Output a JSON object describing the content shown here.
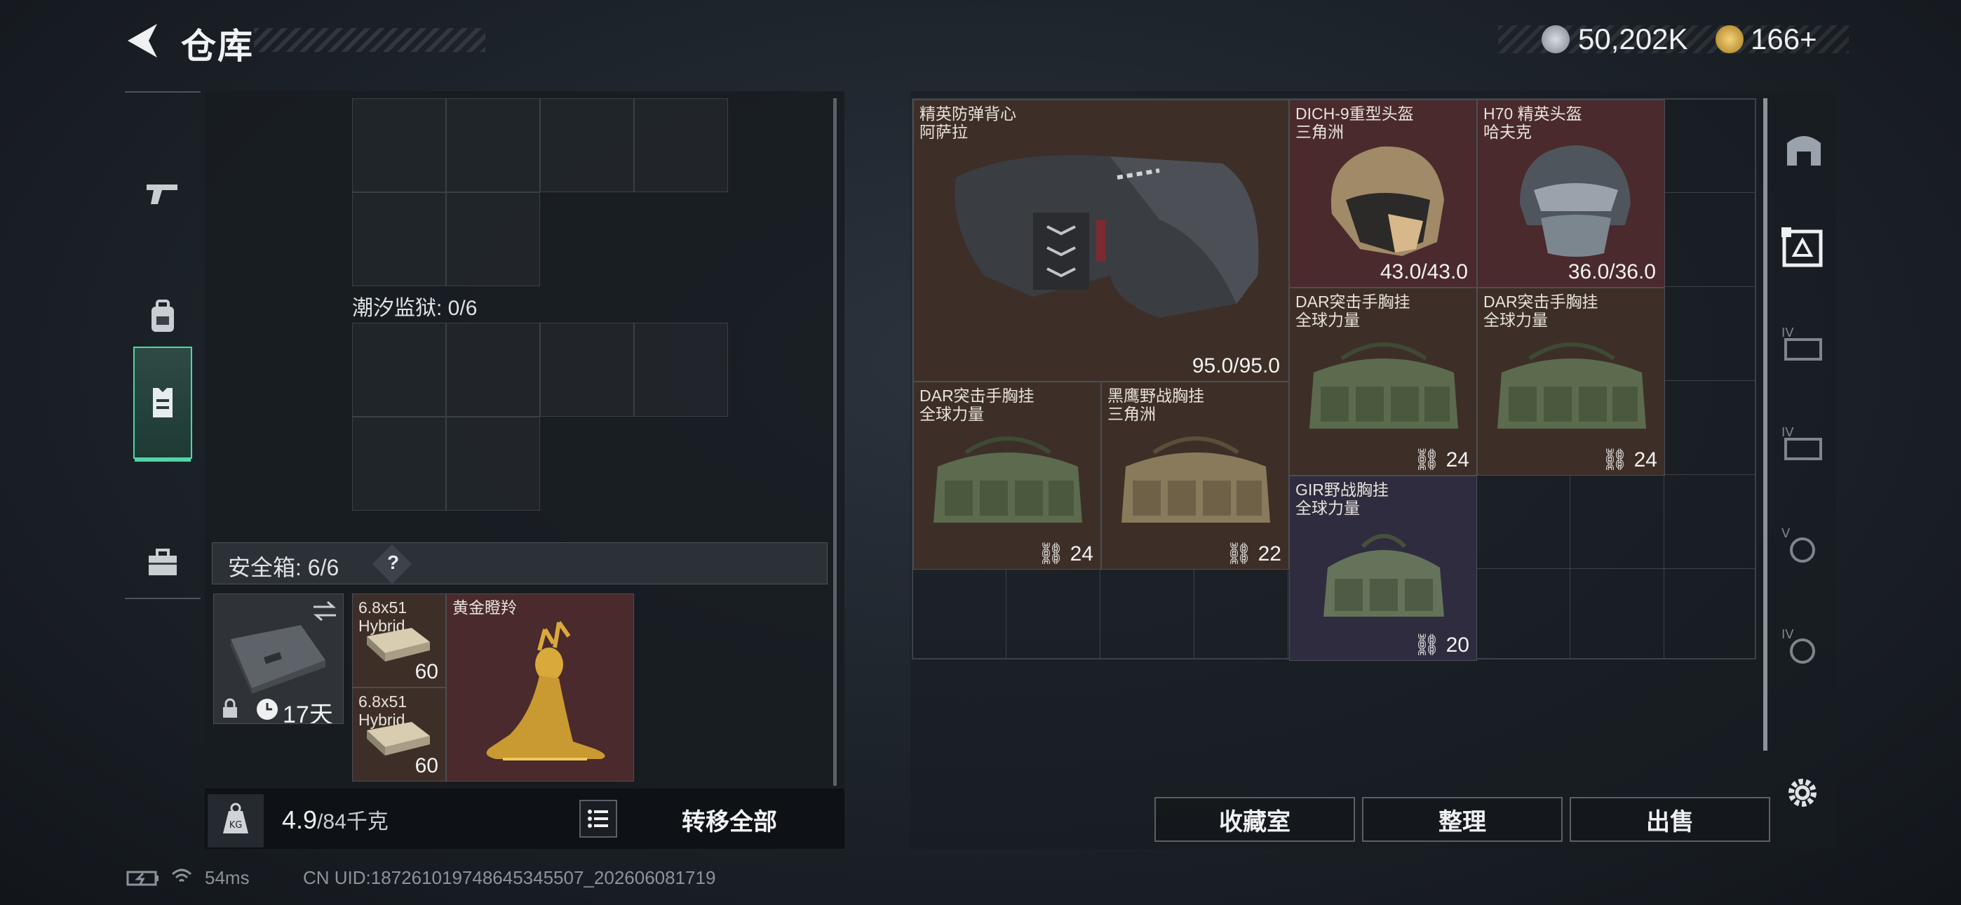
{
  "header": {
    "title": "仓库",
    "currency1": "50,202K",
    "currency2": "166+"
  },
  "sidebar": {
    "tabs": [
      {
        "icon": "pistol-icon"
      },
      {
        "icon": "backpack-icon"
      },
      {
        "icon": "vest-icon",
        "active": true
      },
      {
        "icon": "toolbox-icon"
      }
    ]
  },
  "left": {
    "prison_label": "潮汐监狱: 0/6",
    "safe_label": "安全箱:  6/6",
    "safe_help": "?",
    "case_days": "17天",
    "ammo1_name": "6.8x51\nHybrid",
    "ammo1_count": "60",
    "ammo2_name": "6.8x51\nHybrid",
    "ammo2_count": "60",
    "deer_name": "黄金瞪羚",
    "weight_value": "4.9",
    "weight_unit": "/84千克",
    "transfer_all": "转移全部"
  },
  "right": {
    "items": [
      {
        "name": "精英防弹背心\n阿萨拉",
        "value": "95.0/95.0"
      },
      {
        "name": "DICH-9重型头盔\n三角洲",
        "value": "43.0/43.0"
      },
      {
        "name": "H70 精英头盔\n哈夫克",
        "value": "36.0/36.0"
      },
      {
        "name": "DAR突击手胸挂\n全球力量",
        "value": "24"
      },
      {
        "name": "DAR突击手胸挂\n全球力量",
        "value": "24"
      },
      {
        "name": "DAR突击手胸挂\n全球力量",
        "value": "24"
      },
      {
        "name": "黑鹰野战胸挂\n三角洲",
        "value": "22"
      },
      {
        "name": "GIR野战胸挂\n全球力量",
        "value": "20"
      }
    ],
    "btn_collection": "收藏室",
    "btn_sort": "整理",
    "btn_sell": "出售"
  },
  "status": {
    "ping": "54ms",
    "uid": "CN UID:187261019748645345507_202606081719"
  },
  "colors": {
    "accent": "#4fd6a6",
    "brown_cell": "#3d2f27",
    "red_cell": "#4a2a2c",
    "purple_cell": "#2e2c3e"
  }
}
